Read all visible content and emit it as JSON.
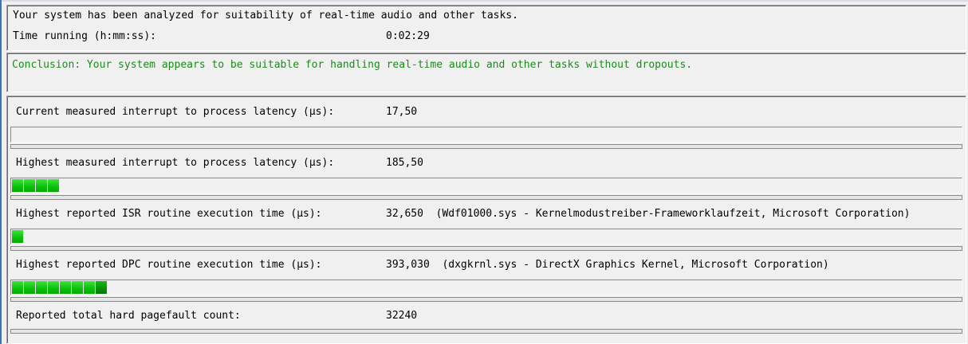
{
  "summary": {
    "analyzed_text": "Your system has been analyzed for suitability of real-time audio and other tasks.",
    "time_label": "Time running (h:mm:ss):",
    "time_value": "0:02:29"
  },
  "conclusion": {
    "text": "Conclusion: Your system appears to be suitable for handling real-time audio and other tasks without dropouts.",
    "color": "#1d8a1d"
  },
  "metrics": [
    {
      "label": "Current measured interrupt to process latency (µs):",
      "value": "17,50",
      "detail": "",
      "bar_segments": 0,
      "bar_dark_segments": 0
    },
    {
      "label": "Highest measured interrupt to process latency (µs):",
      "value": "185,50",
      "detail": "",
      "bar_segments": 4,
      "bar_dark_segments": 0
    },
    {
      "label": "Highest reported ISR routine execution time (µs):",
      "value": "32,650",
      "detail": "(Wdf01000.sys - Kernelmodustreiber-Frameworklaufzeit, Microsoft Corporation)",
      "bar_segments": 1,
      "bar_dark_segments": 0
    },
    {
      "label": "Highest reported DPC routine execution time (µs):",
      "value": "393,030",
      "detail": "(dxgkrnl.sys - DirectX Graphics Kernel, Microsoft Corporation)",
      "bar_segments": 8,
      "bar_dark_segments": 1
    }
  ],
  "pagefault": {
    "label": "Reported total hard pagefault count:",
    "value": "32240"
  },
  "colors": {
    "bar_green": "#08c108",
    "window_edge": "#3b73b9",
    "background": "#f0f0f0"
  }
}
